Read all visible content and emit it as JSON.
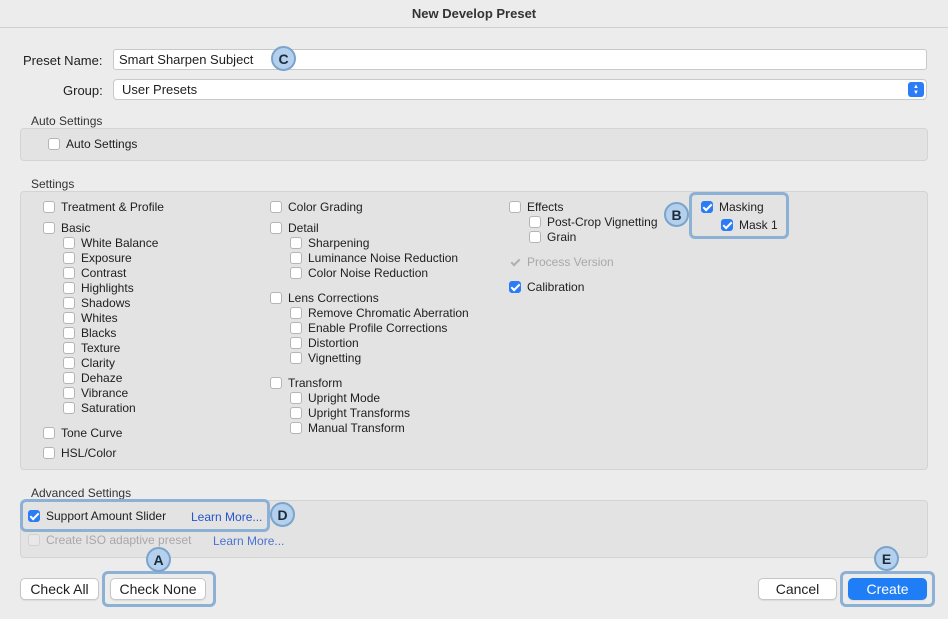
{
  "window": {
    "title": "New Develop Preset"
  },
  "preset_name": {
    "label": "Preset Name:",
    "value": "Smart Sharpen Subject"
  },
  "group": {
    "label": "Group:",
    "value": "User Presets"
  },
  "auto_settings": {
    "title": "Auto Settings",
    "auto_settings_label": "Auto Settings",
    "auto_settings_checked": false
  },
  "settings": {
    "title": "Settings",
    "treatment_profile": "Treatment & Profile",
    "basic": {
      "label": "Basic",
      "items": [
        "White Balance",
        "Exposure",
        "Contrast",
        "Highlights",
        "Shadows",
        "Whites",
        "Blacks",
        "Texture",
        "Clarity",
        "Dehaze",
        "Vibrance",
        "Saturation"
      ]
    },
    "tone_curve": "Tone Curve",
    "hsl_color": "HSL/Color",
    "color_grading": "Color Grading",
    "detail": {
      "label": "Detail",
      "items": [
        "Sharpening",
        "Luminance Noise Reduction",
        "Color Noise Reduction"
      ]
    },
    "lens_corrections": {
      "label": "Lens Corrections",
      "items": [
        "Remove Chromatic Aberration",
        "Enable Profile Corrections",
        "Distortion",
        "Vignetting"
      ]
    },
    "transform": {
      "label": "Transform",
      "items": [
        "Upright Mode",
        "Upright Transforms",
        "Manual Transform"
      ]
    },
    "effects": {
      "label": "Effects",
      "items": [
        "Post-Crop Vignetting",
        "Grain"
      ]
    },
    "process_version": "Process Version",
    "calibration": "Calibration",
    "masking": {
      "label": "Masking",
      "mask1": "Mask 1"
    }
  },
  "advanced": {
    "title": "Advanced Settings",
    "support_amount_slider": "Support Amount Slider",
    "learn_more_1": "Learn More...",
    "iso_adaptive": "Create ISO adaptive preset",
    "learn_more_2": "Learn More..."
  },
  "buttons": {
    "check_all": "Check All",
    "check_none": "Check None",
    "cancel": "Cancel",
    "create": "Create"
  },
  "callouts": {
    "a": "A",
    "b": "B",
    "c": "C",
    "d": "D",
    "e": "E"
  },
  "colors": {
    "accent": "#1f7ef5",
    "highlight": "#8cb1d4",
    "link": "#2456c9"
  }
}
